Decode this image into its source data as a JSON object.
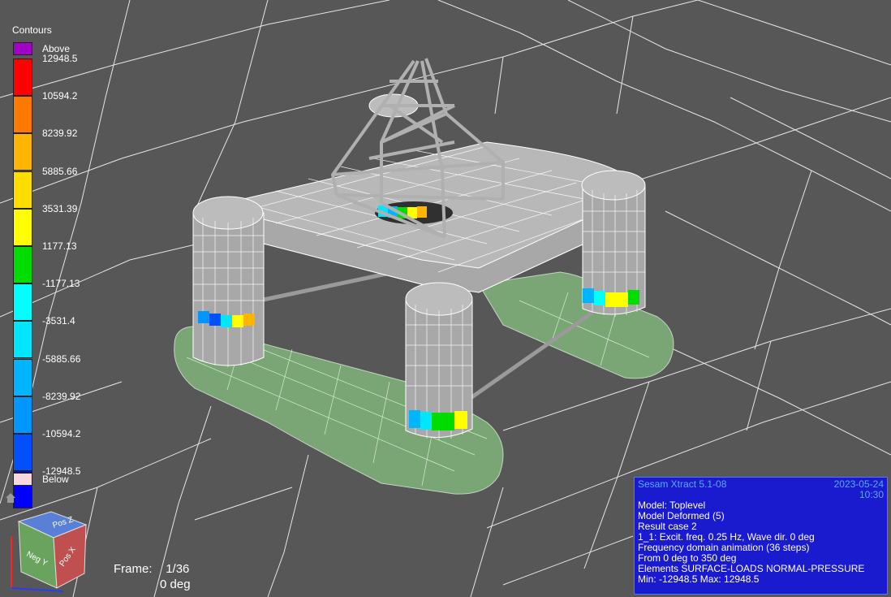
{
  "legend": {
    "title": "Contours",
    "above": {
      "label": "Above",
      "color": "#a000c8"
    },
    "below": {
      "label": "Below",
      "color": "#f8d8e0"
    },
    "levels": [
      {
        "label": "12948.5",
        "color": "#ff0000"
      },
      {
        "label": "10594.2",
        "color": "#ff7800"
      },
      {
        "label": "8239.92",
        "color": "#ffb400"
      },
      {
        "label": "5885.66",
        "color": "#ffdc00"
      },
      {
        "label": "3531.39",
        "color": "#ffff00"
      },
      {
        "label": "1177.13",
        "color": "#00dc00"
      },
      {
        "label": "-1177.13",
        "color": "#00ffff"
      },
      {
        "label": "-3531.4",
        "color": "#00e6ff"
      },
      {
        "label": "-5885.66",
        "color": "#00b4ff"
      },
      {
        "label": "-8239.92",
        "color": "#0096ff"
      },
      {
        "label": "-10594.2",
        "color": "#0050ff"
      },
      {
        "label": "-12948.5",
        "color": "#0000ff"
      }
    ]
  },
  "frame": {
    "label": "Frame:",
    "value": "1/36",
    "angle": "0 deg"
  },
  "info": {
    "app": "Sesam Xtract 5.1-08",
    "date": "2023-05-24",
    "time": "10:30",
    "lines": [
      "Model: Toplevel",
      "Model Deformed (5)",
      "Result case 2",
      "1_1: Excit. freq. 0.25 Hz, Wave dir. 0 deg",
      "Frequency domain animation (36 steps)",
      "From 0 deg to 350 deg",
      "Elements SURFACE-LOADS NORMAL-PRESSURE",
      "Min: -12948.5 Max: 12948.5"
    ]
  },
  "view_cube": {
    "top": "Pos Z",
    "left": "Neg Y",
    "right": "Pos X"
  },
  "colors": {
    "background": "#575757",
    "grid": "#ffffff",
    "pontoon": "#86c07e",
    "column": "#a8a8a8",
    "truss": "#b0b0b0",
    "panel": "#1a1acf"
  }
}
